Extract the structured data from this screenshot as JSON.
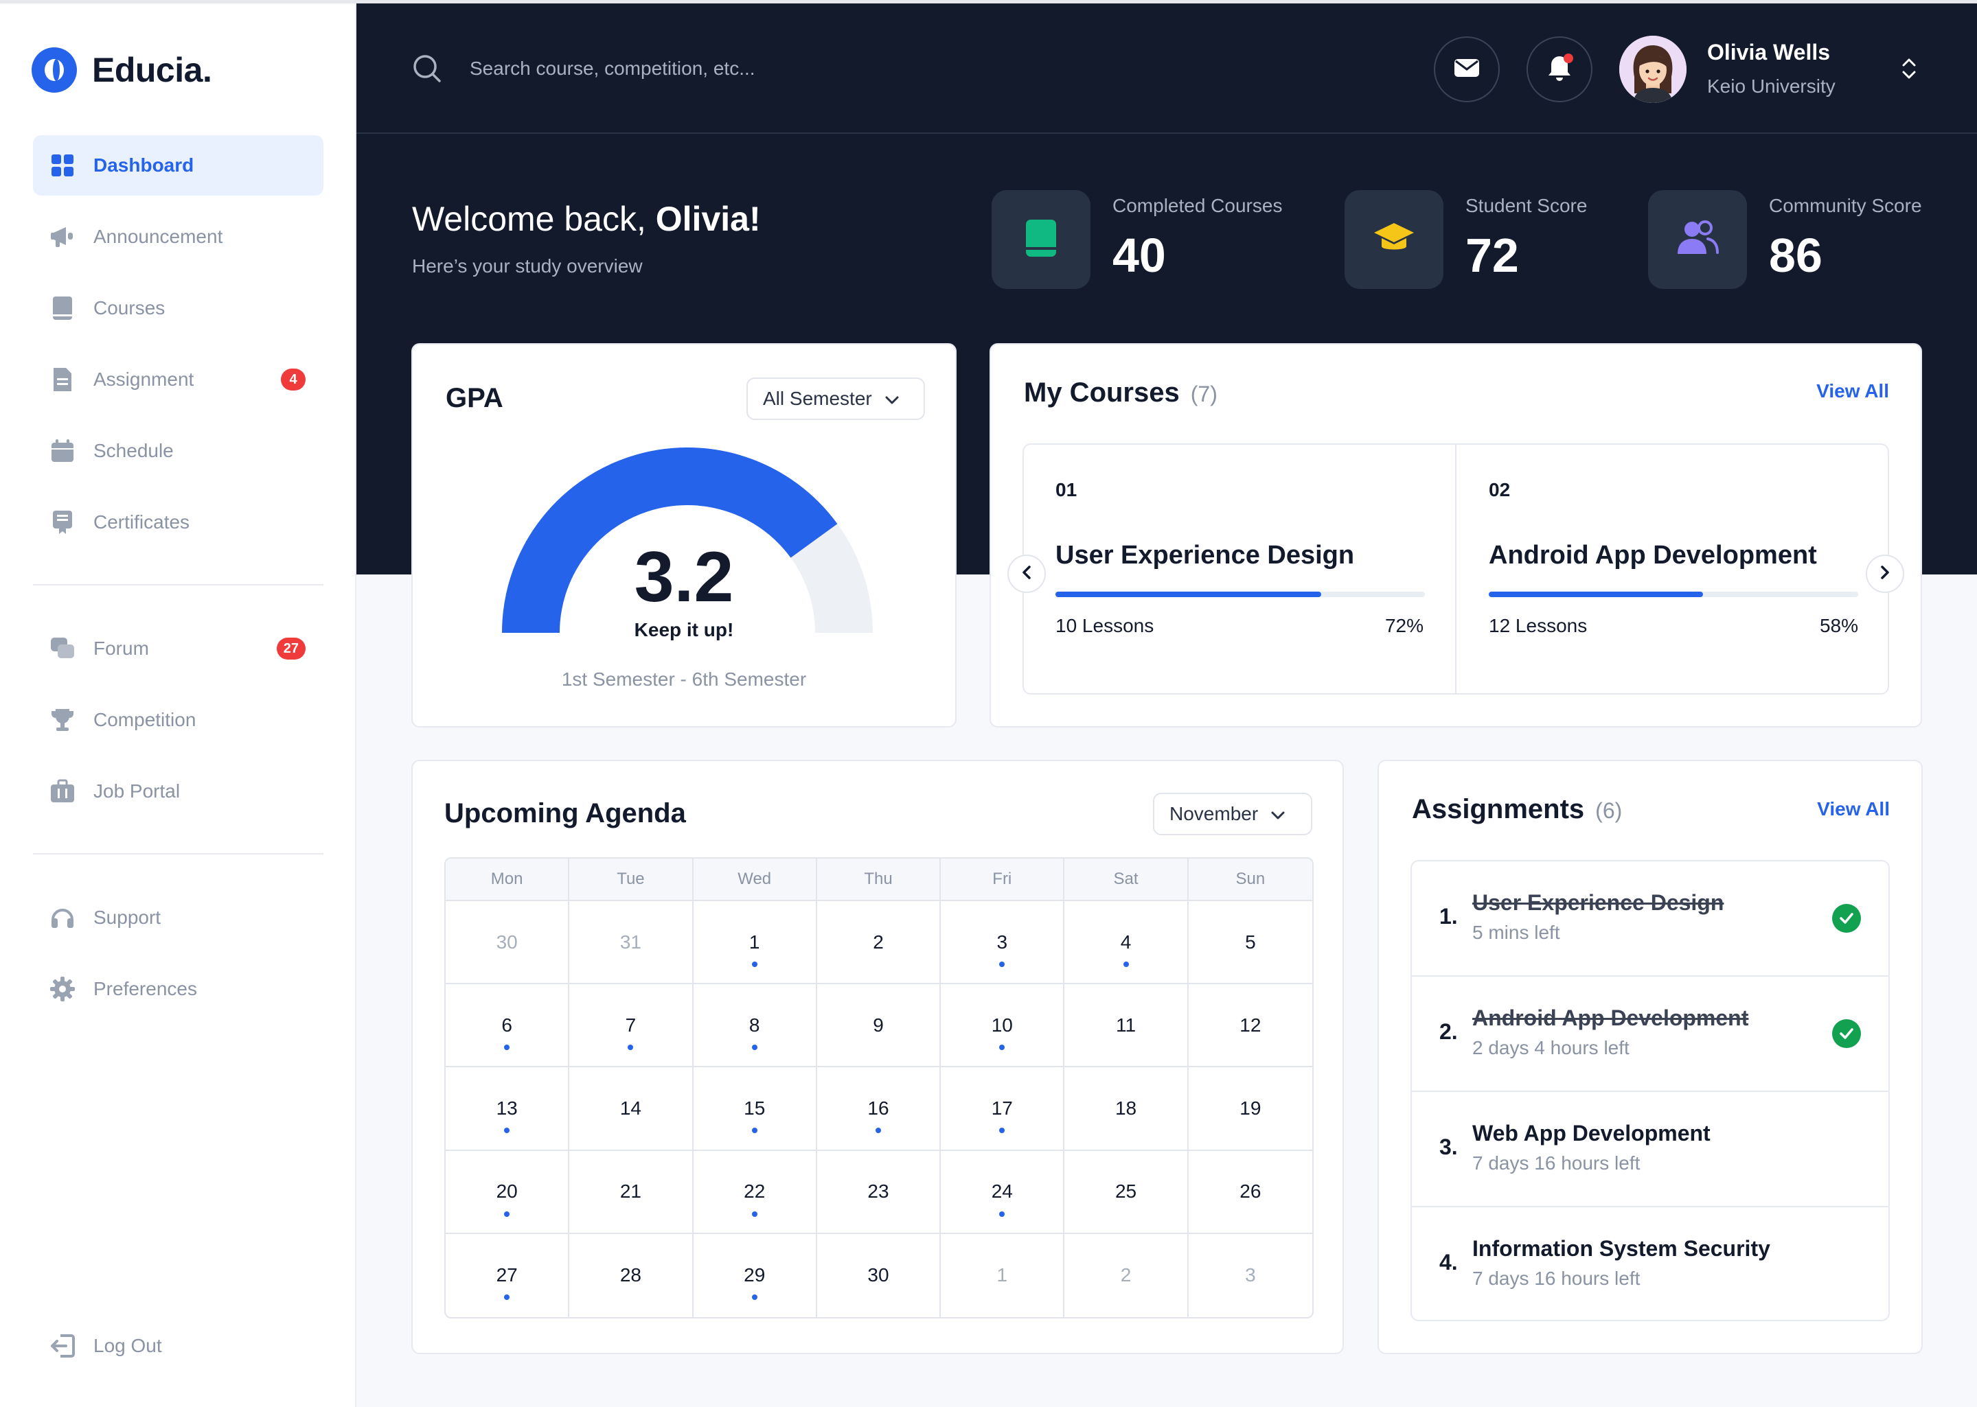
{
  "brand": {
    "name": "Educia."
  },
  "sidebar": {
    "items": [
      {
        "label": "Dashboard"
      },
      {
        "label": "Announcement"
      },
      {
        "label": "Courses"
      },
      {
        "label": "Assignment",
        "badge": "4"
      },
      {
        "label": "Schedule"
      },
      {
        "label": "Certificates"
      },
      {
        "label": "Forum",
        "badge": "27"
      },
      {
        "label": "Competition"
      },
      {
        "label": "Job Portal"
      },
      {
        "label": "Support"
      },
      {
        "label": "Preferences"
      },
      {
        "label": "Log Out"
      }
    ]
  },
  "header": {
    "search_placeholder": "Search course, competition, etc...",
    "user": {
      "name": "Olivia Wells",
      "school": "Keio University"
    }
  },
  "welcome": {
    "greeting": "Welcome back, ",
    "name": "Olivia!",
    "subtitle": "Here’s your study overview"
  },
  "stats": [
    {
      "label": "Completed Courses",
      "value": "40"
    },
    {
      "label": "Student Score",
      "value": "72"
    },
    {
      "label": "Community Score",
      "value": "86"
    }
  ],
  "gpa": {
    "title": "GPA",
    "filter": "All Semester",
    "value": "3.2",
    "max": 4,
    "message": "Keep it up!",
    "range": "1st Semester - 6th Semester"
  },
  "my_courses": {
    "title": "My Courses",
    "count": "(7)",
    "view_all": "View All",
    "items": [
      {
        "num": "01",
        "name": "User Experience Design",
        "lessons": "10 Lessons",
        "progress": "72%",
        "progress_value": 72
      },
      {
        "num": "02",
        "name": "Android App Development",
        "lessons": "12 Lessons",
        "progress": "58%",
        "progress_value": 58
      }
    ]
  },
  "agenda": {
    "title": "Upcoming Agenda",
    "month": "November",
    "weekdays": [
      "Mon",
      "Tue",
      "Wed",
      "Thu",
      "Fri",
      "Sat",
      "Sun"
    ],
    "days": [
      {
        "d": "30",
        "muted": true,
        "dot": false
      },
      {
        "d": "31",
        "muted": true,
        "dot": false
      },
      {
        "d": "1",
        "muted": false,
        "dot": true
      },
      {
        "d": "2",
        "muted": false,
        "dot": false
      },
      {
        "d": "3",
        "muted": false,
        "dot": true
      },
      {
        "d": "4",
        "muted": false,
        "dot": true
      },
      {
        "d": "5",
        "muted": false,
        "dot": false
      },
      {
        "d": "6",
        "muted": false,
        "dot": true
      },
      {
        "d": "7",
        "muted": false,
        "dot": true
      },
      {
        "d": "8",
        "muted": false,
        "dot": true
      },
      {
        "d": "9",
        "muted": false,
        "dot": false
      },
      {
        "d": "10",
        "muted": false,
        "dot": true
      },
      {
        "d": "11",
        "muted": false,
        "dot": false
      },
      {
        "d": "12",
        "muted": false,
        "dot": false
      },
      {
        "d": "13",
        "muted": false,
        "dot": true
      },
      {
        "d": "14",
        "muted": false,
        "dot": false
      },
      {
        "d": "15",
        "muted": false,
        "dot": true
      },
      {
        "d": "16",
        "muted": false,
        "dot": true
      },
      {
        "d": "17",
        "muted": false,
        "dot": true
      },
      {
        "d": "18",
        "muted": false,
        "dot": false
      },
      {
        "d": "19",
        "muted": false,
        "dot": false
      },
      {
        "d": "20",
        "muted": false,
        "dot": true
      },
      {
        "d": "21",
        "muted": false,
        "dot": false
      },
      {
        "d": "22",
        "muted": false,
        "dot": true
      },
      {
        "d": "23",
        "muted": false,
        "dot": false
      },
      {
        "d": "24",
        "muted": false,
        "dot": true
      },
      {
        "d": "25",
        "muted": false,
        "dot": false
      },
      {
        "d": "26",
        "muted": false,
        "dot": false
      },
      {
        "d": "27",
        "muted": false,
        "dot": true
      },
      {
        "d": "28",
        "muted": false,
        "dot": false
      },
      {
        "d": "29",
        "muted": false,
        "dot": true
      },
      {
        "d": "30",
        "muted": false,
        "dot": false
      },
      {
        "d": "1",
        "muted": true,
        "dot": false
      },
      {
        "d": "2",
        "muted": true,
        "dot": false
      },
      {
        "d": "3",
        "muted": true,
        "dot": false
      }
    ]
  },
  "assignments": {
    "title": "Assignments",
    "count": "(6)",
    "view_all": "View All",
    "items": [
      {
        "num": "1.",
        "title": "User Experience Design",
        "time": "5 mins left",
        "done": true
      },
      {
        "num": "2.",
        "title": "Android App Development",
        "time": "2 days 4 hours left",
        "done": true
      },
      {
        "num": "3.",
        "title": "Web App Development",
        "time": "7 days 16 hours left",
        "done": false
      },
      {
        "num": "4.",
        "title": "Information System Security",
        "time": "7 days 16 hours left",
        "done": false
      }
    ]
  },
  "colors": {
    "accent": "#2563eb",
    "dark": "#121a2c",
    "danger": "#ef3b3b",
    "success": "#12a150",
    "book_icon": "#10b981",
    "cap_icon": "#f5c518",
    "community_icon": "#8b7cf6"
  }
}
